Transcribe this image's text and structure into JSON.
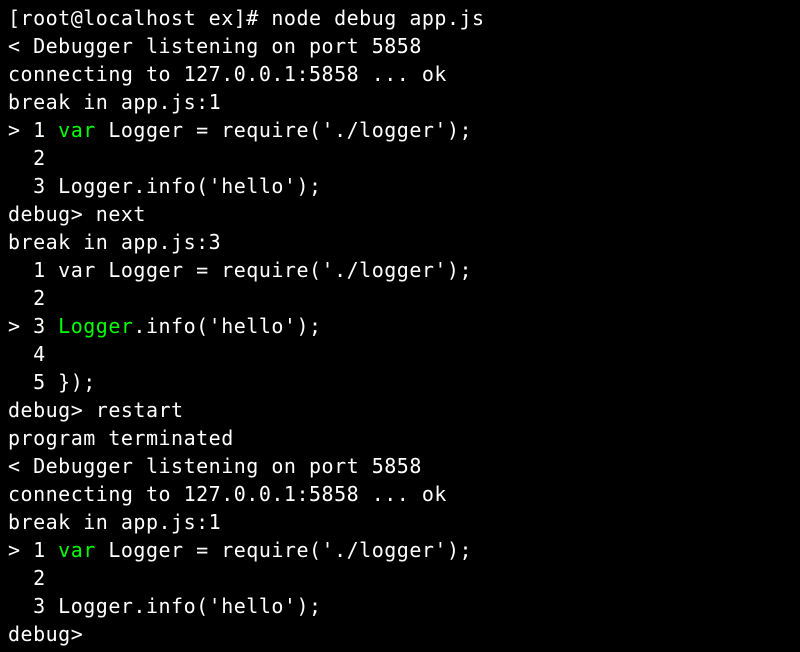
{
  "terminal": {
    "prompt": "[root@localhost ex]# ",
    "command": "node debug app.js",
    "lines": {
      "l1": "< Debugger listening on port 5858",
      "l2": "connecting to 127.0.0.1:5858 ... ok",
      "l3": "break in app.js:1",
      "l4_prefix": "> 1 ",
      "l4_keyword": "var",
      "l4_rest": " Logger = require('./logger');",
      "l5": "  2 ",
      "l6": "  3 Logger.info('hello');",
      "l7": "debug> next",
      "l8": "break in app.js:3",
      "l9": "  1 var Logger = require('./logger');",
      "l10": "  2 ",
      "l11_prefix": "> 3 ",
      "l11_keyword": "Logger",
      "l11_rest": ".info('hello');",
      "l12": "  4 ",
      "l13": "  5 });",
      "l14": "debug> restart",
      "l15": "program terminated",
      "l16": "< Debugger listening on port 5858",
      "l17": "connecting to 127.0.0.1:5858 ... ok",
      "l18": "break in app.js:1",
      "l19_prefix": "> 1 ",
      "l19_keyword": "var",
      "l19_rest": " Logger = require('./logger');",
      "l20": "  2 ",
      "l21": "  3 Logger.info('hello');",
      "l22": "debug> "
    }
  }
}
